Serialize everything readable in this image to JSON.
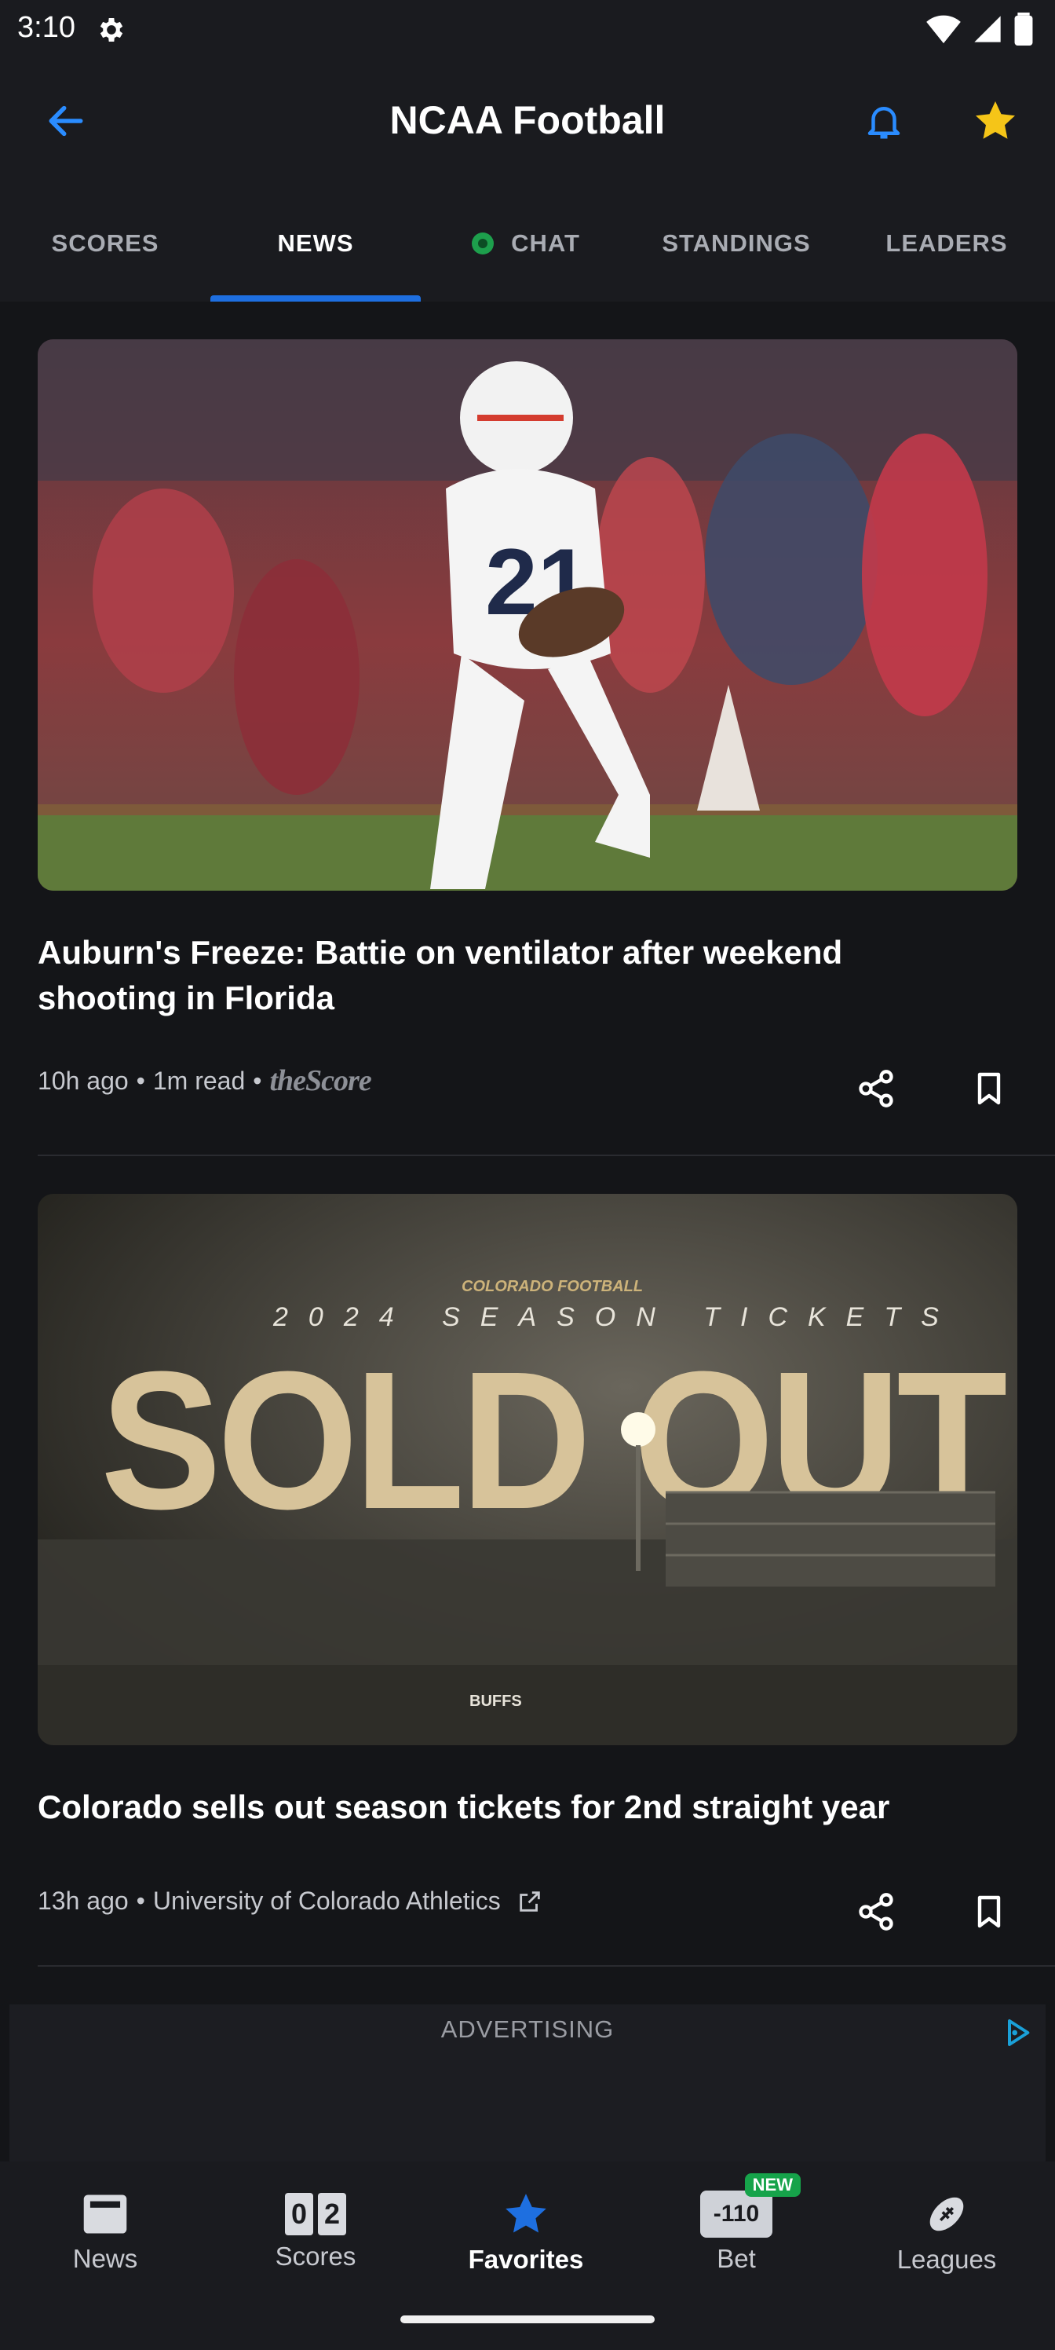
{
  "status_bar": {
    "time": "3:10"
  },
  "app_bar": {
    "title": "NCAA Football"
  },
  "tabs": [
    {
      "label": "SCORES"
    },
    {
      "label": "NEWS"
    },
    {
      "label": "CHAT"
    },
    {
      "label": "STANDINGS"
    },
    {
      "label": "LEADERS"
    }
  ],
  "articles": [
    {
      "headline": "Auburn's Freeze: Battie on ventilator after weekend shooting in Florida",
      "time": "10h ago",
      "read_time": "1m read",
      "source": "theScore"
    },
    {
      "headline": "Colorado sells out season tickets for 2nd straight year",
      "time": "13h ago",
      "source": "University of Colorado Athletics",
      "image_text": {
        "brand": "COLORADO FOOTBALL",
        "subtitle": "2024 SEASON TICKETS",
        "headline": "SOLD OUT",
        "sponsor": "BUFFS"
      }
    }
  ],
  "ad": {
    "label": "ADVERTISING"
  },
  "bottom_nav": [
    {
      "label": "News",
      "icon": "news-icon"
    },
    {
      "label": "Scores",
      "icon": "scores-icon",
      "digits": [
        "0",
        "2"
      ]
    },
    {
      "label": "Favorites",
      "icon": "star-icon"
    },
    {
      "label": "Bet",
      "icon": "bet-icon",
      "odds": "-110",
      "badge": "NEW"
    },
    {
      "label": "Leagues",
      "icon": "football-icon"
    }
  ],
  "colors": {
    "accent": "#1e6fe0",
    "favorite": "#f5c518",
    "live": "#1d9f4c",
    "background": "#141518"
  }
}
